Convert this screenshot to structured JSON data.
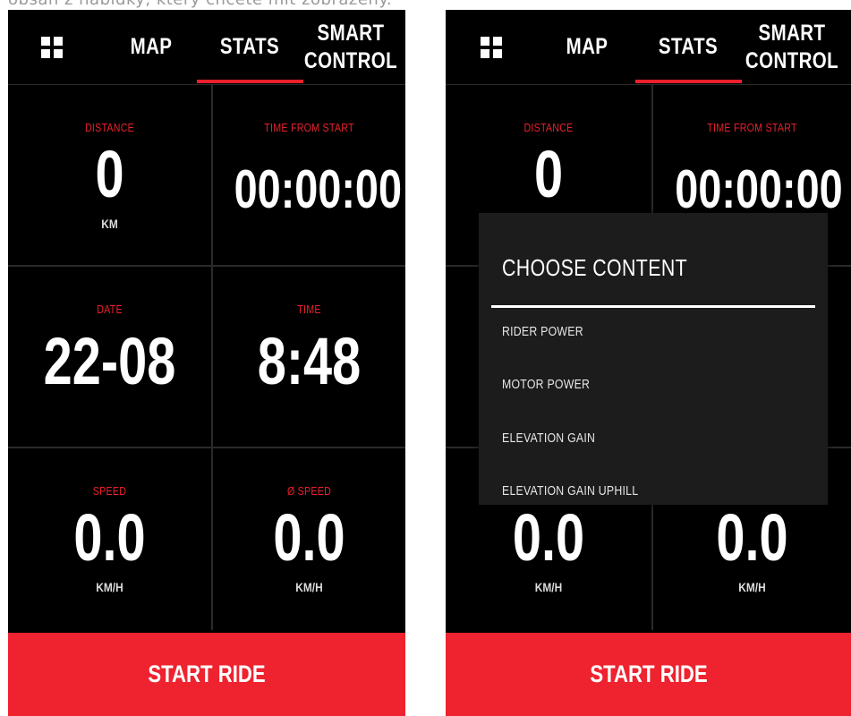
{
  "caption": "obsah z nabídky, který chcete mít zobrazený.",
  "nav": {
    "map": "MAP",
    "stats": "STATS",
    "smart_line1": "SMART",
    "smart_line2": "CONTROL"
  },
  "tiles": {
    "distance": {
      "label": "DISTANCE",
      "value": "0",
      "unit": "KM"
    },
    "time_from_start": {
      "label": "TIME FROM START",
      "value": "00:00:00"
    },
    "date": {
      "label": "DATE",
      "value": "22-08"
    },
    "time": {
      "label": "TIME",
      "value": "8:48"
    },
    "speed": {
      "label": "SPEED",
      "value": "0.0",
      "unit": "KM/H"
    },
    "avg_speed": {
      "label": "Ø SPEED",
      "value": "0.0",
      "unit": "KM/H"
    }
  },
  "start_button": "START RIDE",
  "modal": {
    "title": "CHOOSE CONTENT",
    "items": [
      "RIDER POWER",
      "MOTOR POWER",
      "ELEVATION GAIN",
      "ELEVATION GAIN UPHILL"
    ]
  },
  "colors": {
    "accent": "#e8202b",
    "button": "#ee232f",
    "background": "#000000",
    "modal": "#1c1c1c"
  }
}
